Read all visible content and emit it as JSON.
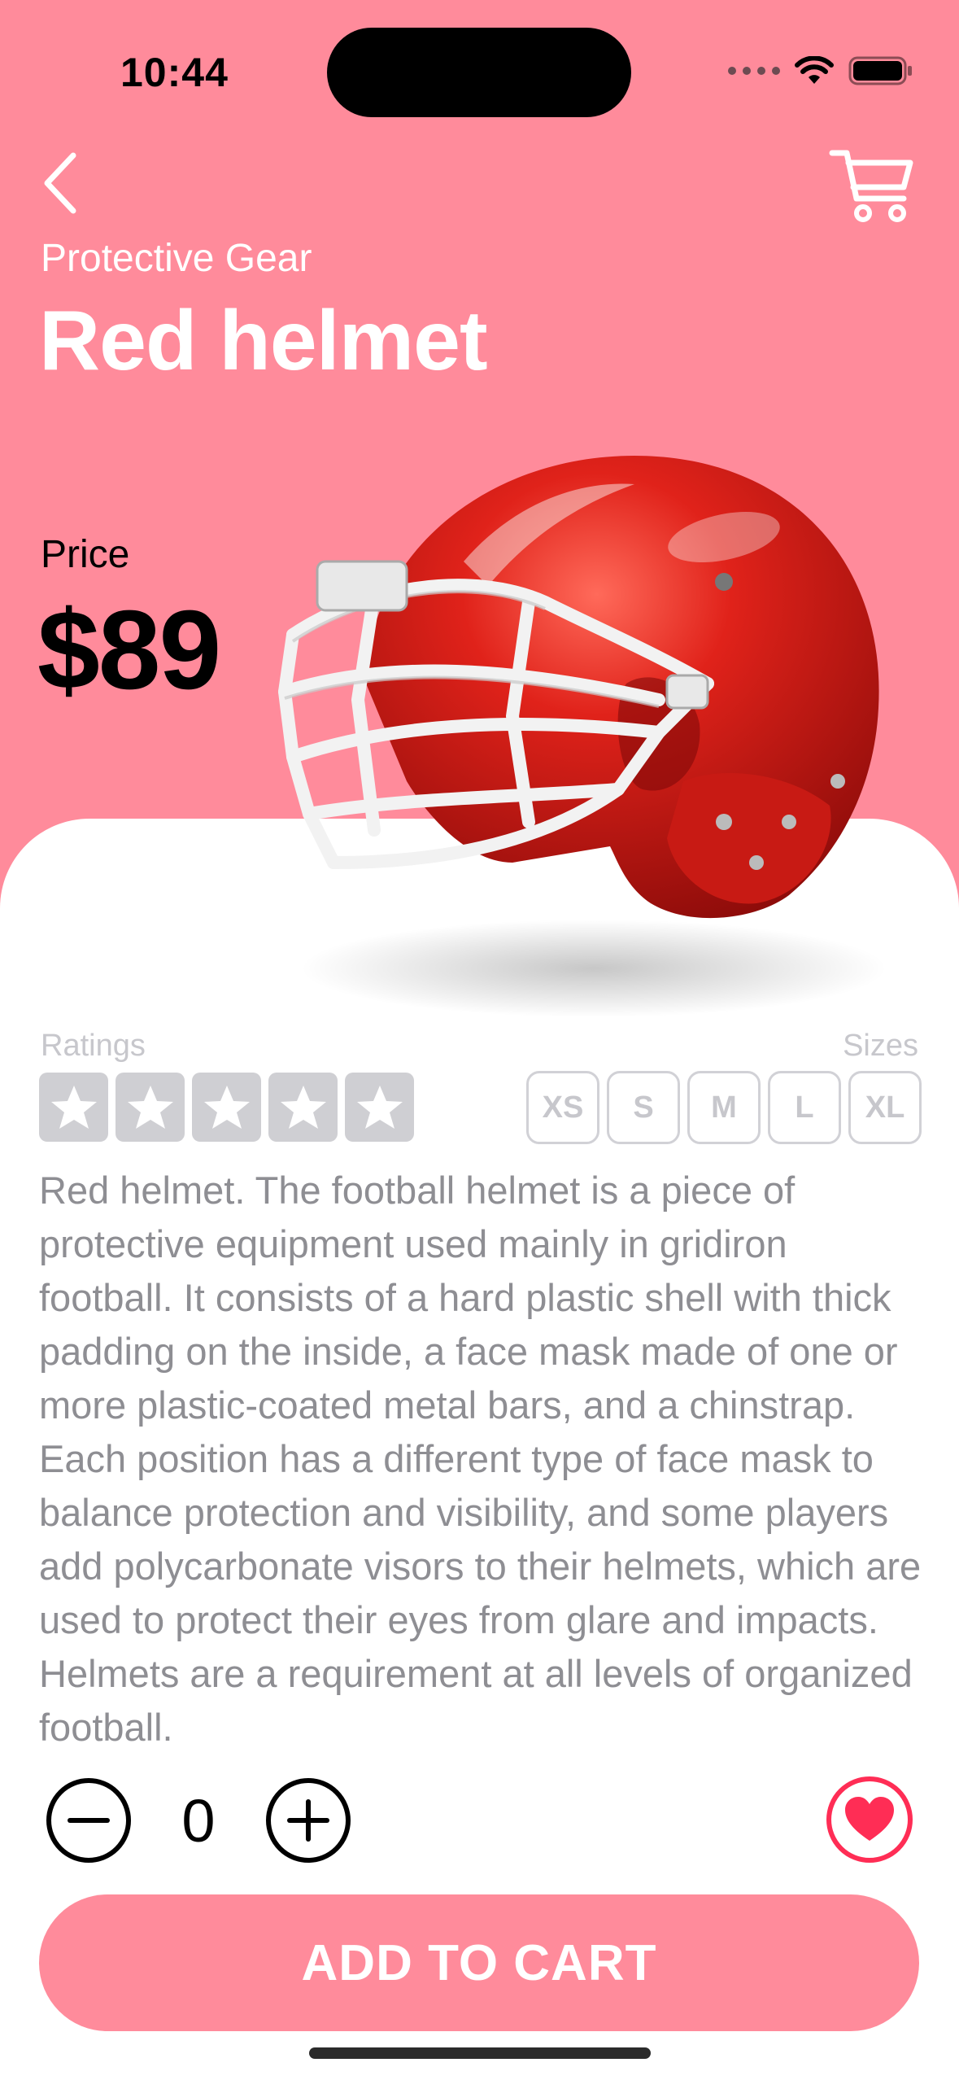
{
  "status_bar": {
    "time": "10:44"
  },
  "product": {
    "category": "Protective Gear",
    "name": "Red helmet",
    "price_label": "Price",
    "price": "$89",
    "description": "Red helmet. The football helmet is a piece of protective equipment used mainly in gridiron football. It consists of a hard plastic shell with thick padding on the inside, a face mask made of one or more plastic-coated metal bars, and a chinstrap. Each position has a different type of face mask to balance protection and visibility, and some players add polycarbonate visors to their helmets, which are used to protect their eyes from glare and impacts. Helmets are a requirement at all levels of organized football."
  },
  "ratings": {
    "label": "Ratings",
    "stars_filled": 0,
    "stars_total": 5
  },
  "sizes": {
    "label": "Sizes",
    "options": [
      "XS",
      "S",
      "M",
      "L",
      "XL"
    ]
  },
  "quantity": {
    "value": "0"
  },
  "cta": {
    "add_to_cart": "ADD TO CART"
  },
  "colors": {
    "accent": "#ff8b9b",
    "favorite": "#ff2d55",
    "muted": "#c7c7cc"
  }
}
